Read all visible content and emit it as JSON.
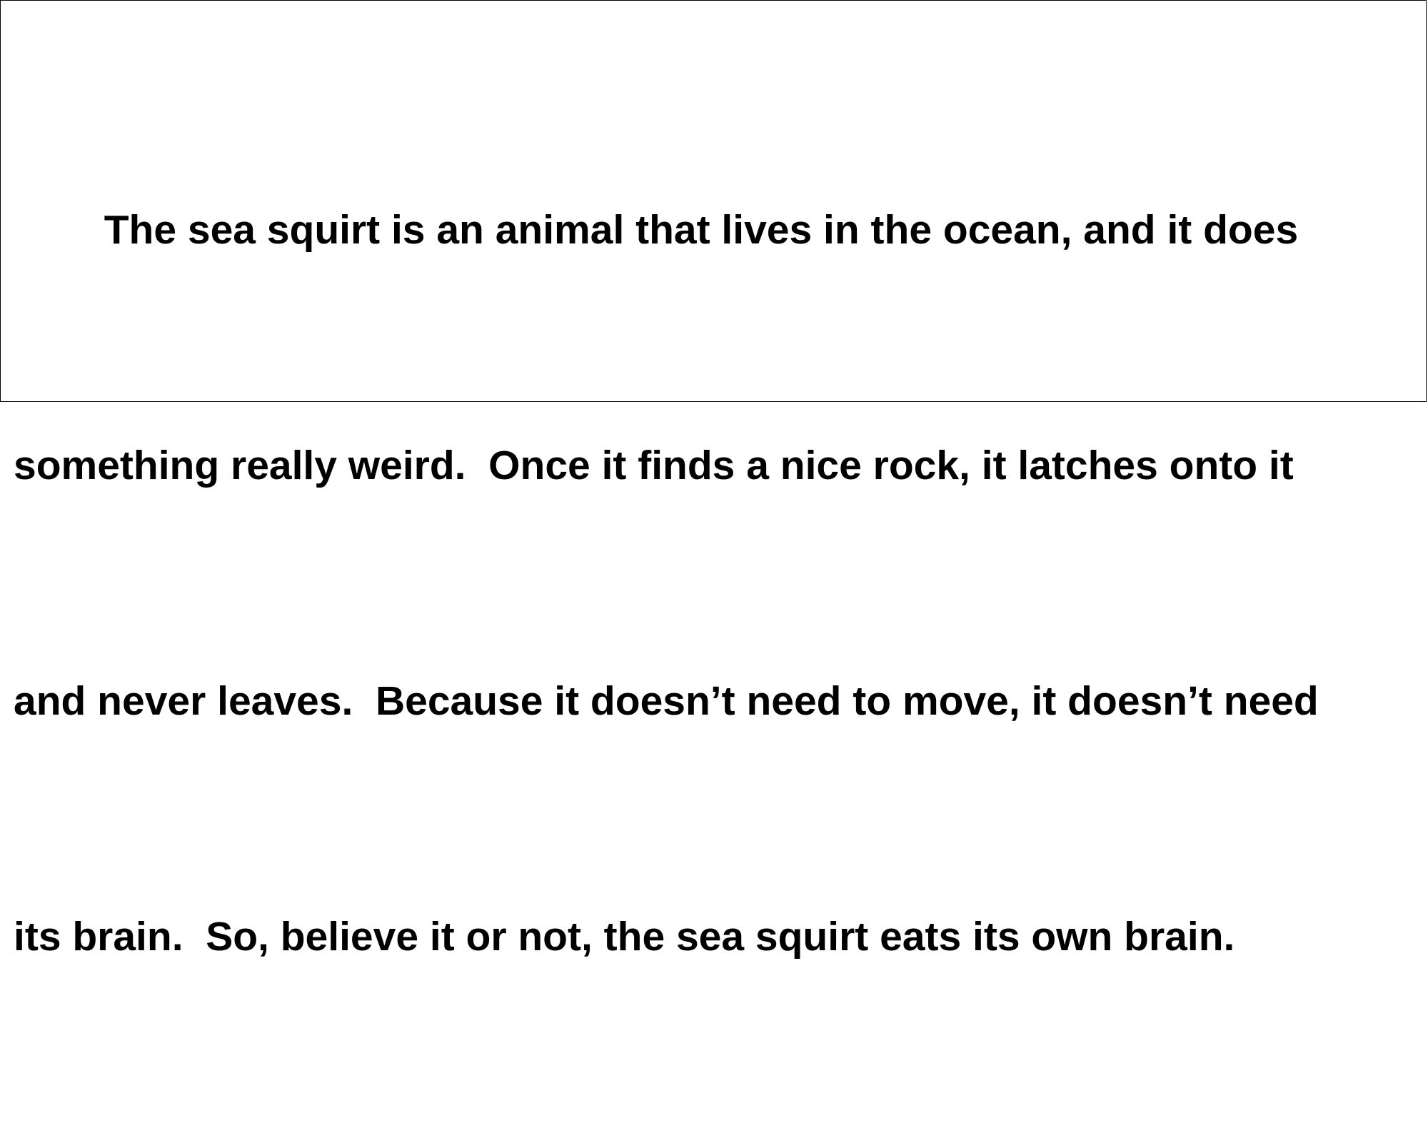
{
  "document": {
    "paragraph_lines": [
      "\tThe sea squirt is an animal that lives in the ocean, and it does",
      "something really weird.  Once it finds a nice rock, it latches onto it",
      "and never leaves.  Because it doesn’t need to move, it doesn’t need",
      "its brain.  So, believe it or not, the sea squirt eats its own brain."
    ]
  }
}
